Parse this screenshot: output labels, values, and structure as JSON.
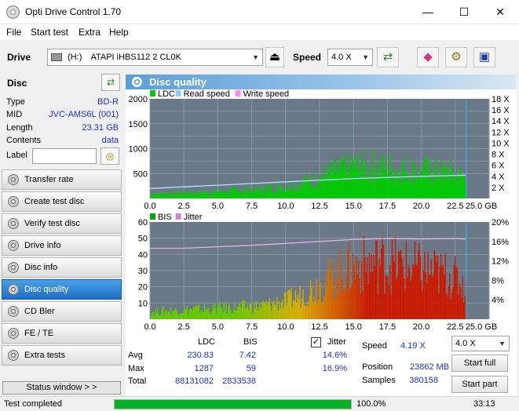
{
  "window": {
    "title": "Opti Drive Control 1.70",
    "minimize": "—",
    "maximize": "☐",
    "close": "✕"
  },
  "menu": [
    "File",
    "Start test",
    "Extra",
    "Help"
  ],
  "toolbar": {
    "drive_label": "Drive",
    "drive_letter": "(H:)",
    "drive_value": "ATAPI iHBS112  2 CL0K",
    "speed_label": "Speed",
    "speed_value": "4.0 X"
  },
  "disc": {
    "header": "Disc",
    "rows": [
      {
        "label": "Type",
        "value": "BD-R"
      },
      {
        "label": "MID",
        "value": "JVC-AMS6L (001)"
      },
      {
        "label": "Length",
        "value": "23.31 GB"
      },
      {
        "label": "Contents",
        "value": "data"
      }
    ],
    "label_field_label": "Label",
    "label_field_value": ""
  },
  "nav": [
    {
      "label": "Transfer rate",
      "active": false
    },
    {
      "label": "Create test disc",
      "active": false
    },
    {
      "label": "Verify test disc",
      "active": false
    },
    {
      "label": "Drive info",
      "active": false
    },
    {
      "label": "Disc info",
      "active": false
    },
    {
      "label": "Disc quality",
      "active": true
    },
    {
      "label": "CD Bler",
      "active": false
    },
    {
      "label": "FE / TE",
      "active": false
    },
    {
      "label": "Extra tests",
      "active": false
    }
  ],
  "status_window_label": "Status window > >",
  "panel_title": "Disc quality",
  "chart_data": [
    {
      "type": "area",
      "legend": [
        "LDC",
        "Read speed",
        "Write speed"
      ],
      "colors": {
        "LDC": "#00cc00",
        "Read speed": "#88ccff",
        "Write speed": "#ff88ff"
      },
      "x_ticks": [
        "0.0",
        "2.5",
        "5.0",
        "7.5",
        "10.0",
        "12.5",
        "15.0",
        "17.5",
        "20.0",
        "22.5",
        "25.0 GB"
      ],
      "y_left_ticks": [
        "2000",
        "1500",
        "1000",
        "500"
      ],
      "y_right_ticks": [
        "18 X",
        "16 X",
        "14 X",
        "12 X",
        "10 X",
        "8 X",
        "6 X",
        "4 X",
        "2 X"
      ],
      "xlim": [
        0,
        25
      ],
      "ylim": [
        0,
        2000
      ],
      "y2lim": [
        0,
        18
      ],
      "disc_end": 23.31,
      "ldc_envelope": {
        "x": [
          0,
          2,
          4,
          6,
          8,
          9,
          10,
          11,
          12,
          13,
          14,
          15,
          16,
          17,
          18,
          19,
          20,
          21,
          22,
          23,
          23.3
        ],
        "y": [
          120,
          140,
          160,
          190,
          220,
          260,
          310,
          380,
          480,
          600,
          700,
          780,
          800,
          780,
          750,
          720,
          700,
          680,
          650,
          560,
          500
        ]
      },
      "read_speed": {
        "x": [
          0,
          5,
          10,
          15,
          20,
          23.3
        ],
        "y": [
          1.8,
          2.4,
          3.0,
          3.6,
          4.0,
          4.2
        ]
      }
    },
    {
      "type": "area",
      "legend": [
        "BIS",
        "Jitter"
      ],
      "colors": {
        "BIS": "#00aa00",
        "Jitter": "#cc88cc"
      },
      "x_ticks": [
        "0.0",
        "2.5",
        "5.0",
        "7.5",
        "10.0",
        "12.5",
        "15.0",
        "17.5",
        "20.0",
        "22.5",
        "25.0 GB"
      ],
      "y_left_ticks": [
        "60",
        "50",
        "40",
        "30",
        "20",
        "10"
      ],
      "y_right_ticks": [
        "20%",
        "16%",
        "12%",
        "8%",
        "4%"
      ],
      "xlim": [
        0,
        25
      ],
      "ylim": [
        0,
        60
      ],
      "y2lim": [
        0,
        20
      ],
      "disc_end": 23.31,
      "bis_envelope": {
        "x": [
          0,
          2,
          4,
          6,
          8,
          9,
          10,
          11,
          12,
          13,
          14,
          15,
          16,
          17,
          18,
          19,
          20,
          21,
          22,
          23,
          23.3
        ],
        "y": [
          6,
          7,
          8,
          9,
          10,
          12,
          14,
          18,
          24,
          30,
          36,
          40,
          42,
          44,
          42,
          40,
          38,
          36,
          34,
          28,
          20
        ]
      },
      "jitter": {
        "x": [
          0,
          2.5,
          5,
          7.5,
          10,
          12.5,
          15,
          17.5,
          20,
          22.5,
          23.3
        ],
        "y": [
          14.6,
          14.6,
          14.9,
          15.2,
          15.6,
          16.0,
          16.4,
          16.6,
          16.5,
          16.6,
          16.5
        ]
      }
    }
  ],
  "stats": {
    "col_ldc": "LDC",
    "col_bis": "BIS",
    "jitter_label": "Jitter",
    "jitter_checked": true,
    "rows": [
      {
        "label": "Avg",
        "ldc": "230.83",
        "bis": "7.42",
        "jitter": "14.6%"
      },
      {
        "label": "Max",
        "ldc": "1287",
        "bis": "59",
        "jitter": "16.9%"
      },
      {
        "label": "Total",
        "ldc": "88131082",
        "bis": "2833538",
        "jitter": ""
      }
    ],
    "speed_label": "Speed",
    "speed_value": "4.19 X",
    "position_label": "Position",
    "position_value": "23862 MB",
    "samples_label": "Samples",
    "samples_value": "380158",
    "speed_select": "4.0 X",
    "start_full": "Start full",
    "start_part": "Start part"
  },
  "statusbar": {
    "text": "Test completed",
    "progress": 100.0,
    "progress_text": "100.0%",
    "time": "33:13"
  }
}
